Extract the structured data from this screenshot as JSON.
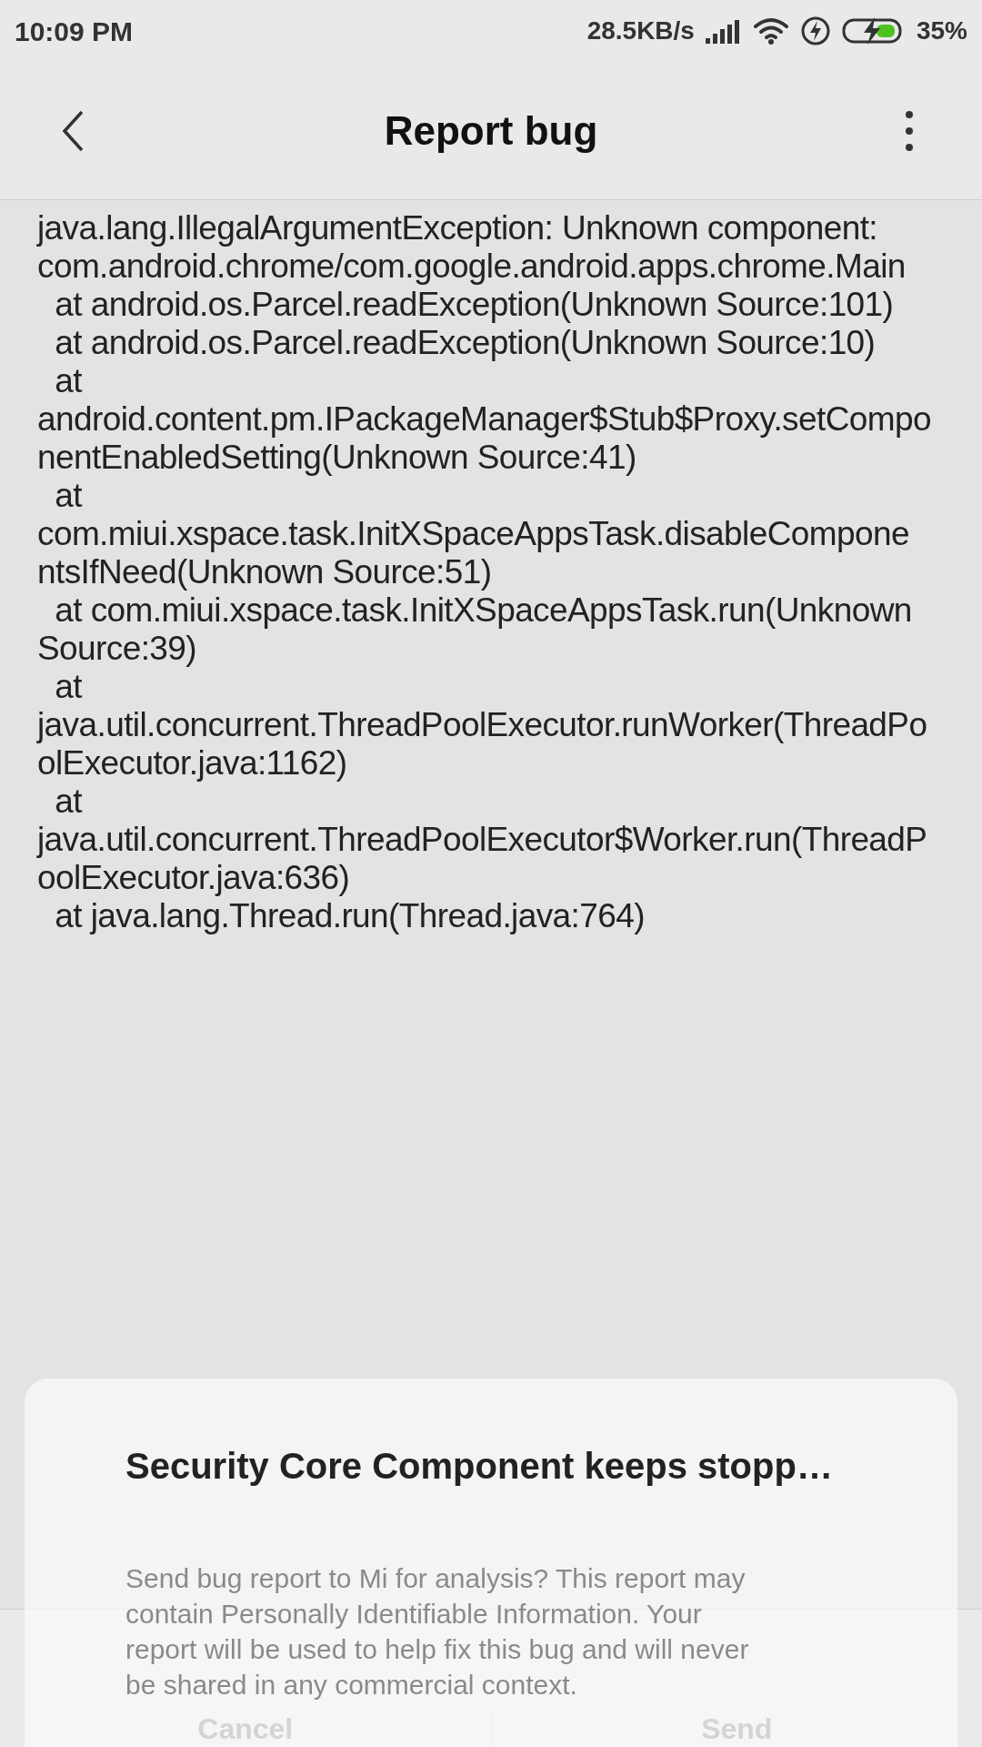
{
  "status_bar": {
    "time": "10:09 PM",
    "network_speed": "28.5KB/s",
    "battery": "35%"
  },
  "header": {
    "title": "Report bug"
  },
  "log_lines": [
    "java.lang.IllegalArgumentException: Unknown component:",
    "com.android.chrome/com.google.android.apps.chrome.Main",
    "  at android.os.Parcel.readException(Unknown Source:101)",
    "  at android.os.Parcel.readException(Unknown Source:10)",
    "  at",
    "android.content.pm.IPackageManager$Stub$Proxy.setCompo",
    "nentEnabledSetting(Unknown Source:41)",
    "  at",
    "com.miui.xspace.task.InitXSpaceAppsTask.disableCompone",
    "ntsIfNeed(Unknown Source:51)",
    "  at com.miui.xspace.task.InitXSpaceAppsTask.run(Unknown",
    "Source:39)",
    "  at",
    "java.util.concurrent.ThreadPoolExecutor.runWorker(ThreadPo",
    "olExecutor.java:1162)",
    "  at",
    "java.util.concurrent.ThreadPoolExecutor$Worker.run(ThreadP",
    "oolExecutor.java:636)",
    "  at java.lang.Thread.run(Thread.java:764)"
  ],
  "bottom_buttons": [
    "Cancel",
    "Send"
  ],
  "dialog": {
    "title": "Security Core Component keeps stopp…",
    "message": "Send bug report to Mi for analysis? This report may contain Personally Identifiable Information. Your report will be used to help fix this bug and will never be shared in any commercial context."
  }
}
